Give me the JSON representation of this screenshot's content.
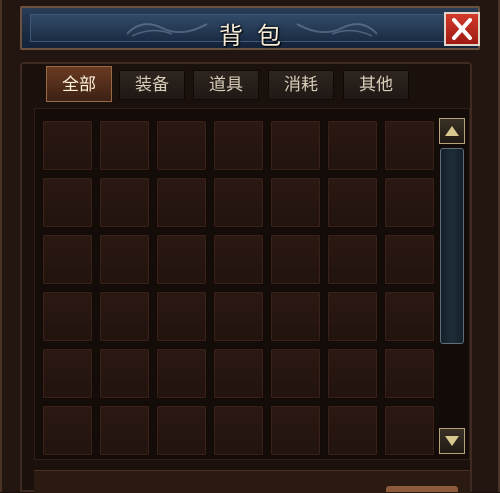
{
  "window": {
    "title": "背包",
    "close_icon": "close-x-icon"
  },
  "tabs": [
    {
      "label": "全部",
      "active": true
    },
    {
      "label": "装备",
      "active": false
    },
    {
      "label": "道具",
      "active": false
    },
    {
      "label": "消耗",
      "active": false
    },
    {
      "label": "其他",
      "active": false
    }
  ],
  "inventory": {
    "columns": 7,
    "visible_rows": 6,
    "slots_filled": 0
  },
  "scrollbar": {
    "up_icon": "triangle-up-icon",
    "down_icon": "triangle-down-icon"
  },
  "colors": {
    "title_bar": "#1e2f46",
    "close_button": "#c0281d",
    "active_tab": "#5a321f",
    "slot": "#261510"
  }
}
